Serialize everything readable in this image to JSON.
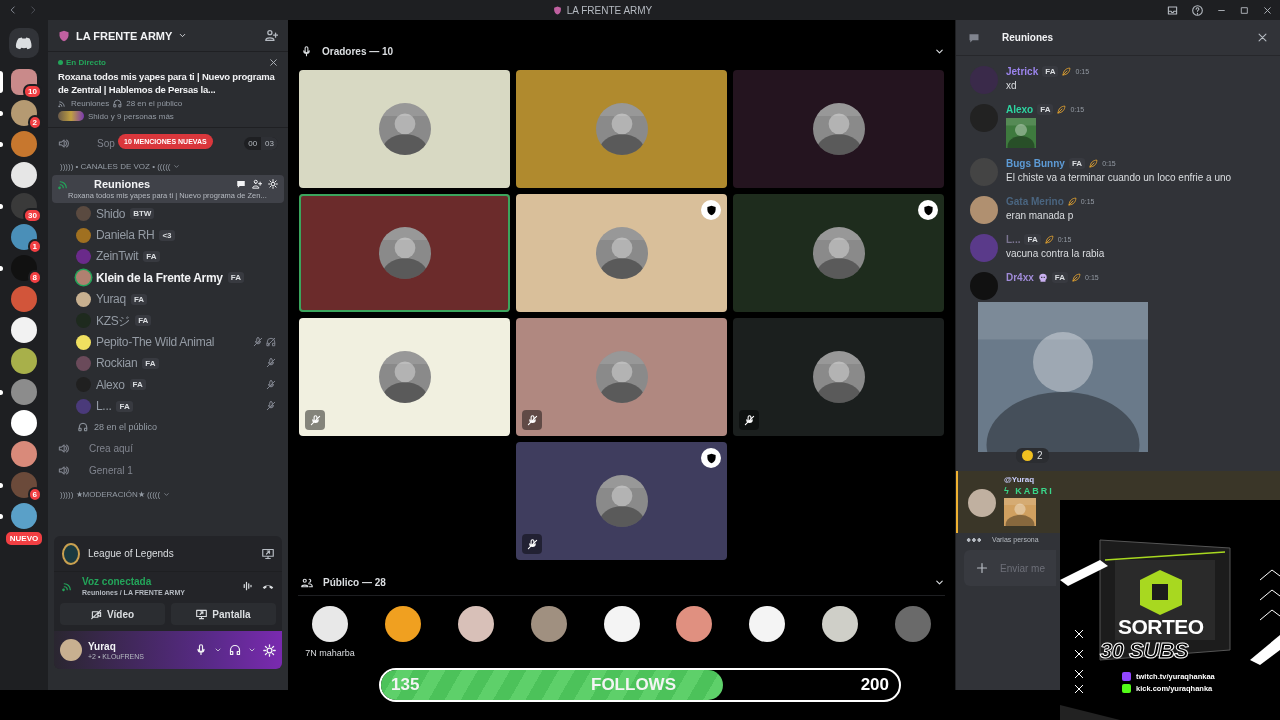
{
  "titlebar": {
    "title": "LA FRENTE ARMY"
  },
  "servers": [
    {
      "badge": "10",
      "selected": true,
      "color": "#c98a8a"
    },
    {
      "badge": "2",
      "selected": false,
      "unread": true,
      "color": "#b59a72"
    },
    {
      "selected": false,
      "unread": true,
      "color": "#c7772e"
    },
    {
      "selected": false,
      "unread": false,
      "color": "#e6e6e6"
    },
    {
      "badge": "30",
      "selected": false,
      "unread": true,
      "color": "#3a3a3a"
    },
    {
      "badge": "1",
      "selected": false,
      "unread": false,
      "color": "#4a8fb8"
    },
    {
      "badge": "8",
      "selected": false,
      "unread": true,
      "color": "#111111"
    },
    {
      "selected": false,
      "unread": false,
      "color": "#d2553a"
    },
    {
      "selected": false,
      "unread": false,
      "color": "#f2f2f2"
    },
    {
      "selected": false,
      "unread": false,
      "color": "#a8b04a"
    },
    {
      "selected": false,
      "unread": true,
      "color": "#8c8c8c"
    },
    {
      "selected": false,
      "unread": false,
      "color": "#ffffff"
    },
    {
      "selected": false,
      "unread": false,
      "color": "#d98a7a"
    },
    {
      "badge": "6",
      "selected": false,
      "unread": true,
      "color": "#6b4a3a"
    },
    {
      "badge": "NUEVO",
      "selected": false,
      "unread": true,
      "color": "#5aa0c8"
    }
  ],
  "sidebar": {
    "server_name": "LA FRENTE ARMY",
    "live": {
      "label": "En Directo",
      "title": "Roxana todos mis yapes para ti | Nuevo programa de Zentral | Hablemos de Persas la...",
      "channel": "Reuniones",
      "audience": "28 en el público",
      "participants": "Shido y 9 personas más"
    },
    "partial_channel": {
      "name": "Sop",
      "counts": [
        "00",
        "03"
      ]
    },
    "mentions": "10 MENCIONES NUEVAS",
    "voice_category": "))))) • CANALES DE VOZ • (((((",
    "active_channel": {
      "name": "Reuniones",
      "topic": "Roxana todos mis yapes para ti | Nuevo programa de Zen...",
      "selected": true
    },
    "members": [
      {
        "name": "Shido",
        "tag": "BTW",
        "speaking": false,
        "muted": false,
        "deafened": false,
        "color": "#5a4a40"
      },
      {
        "name": "Daniela RH",
        "tag": "<3",
        "speaking": false,
        "muted": false,
        "deafened": false,
        "color": "#a07020"
      },
      {
        "name": "ZeinTwit",
        "tag": "FA",
        "speaking": false,
        "muted": false,
        "deafened": false,
        "color": "#6a2a8a"
      },
      {
        "name": "Klein de la Frente Army",
        "tag": "FA",
        "speaking": true,
        "muted": false,
        "deafened": false,
        "color": "#b08070"
      },
      {
        "name": "Yuraq",
        "tag": "FA",
        "speaking": false,
        "muted": false,
        "deafened": false,
        "color": "#c8b090"
      },
      {
        "name": "KZSジ",
        "tag": "FA",
        "speaking": false,
        "muted": false,
        "deafened": false,
        "color": "#1e2a1e"
      },
      {
        "name": "Pepito-The Wild Animal",
        "speaking": false,
        "muted": true,
        "deafened": true,
        "color": "#f0e060"
      },
      {
        "name": "Rockian",
        "tag": "FA",
        "speaking": false,
        "muted": true,
        "deafened": false,
        "color": "#6a4a5a"
      },
      {
        "name": "Alexo",
        "tag": "FA",
        "speaking": false,
        "muted": true,
        "deafened": false,
        "color": "#202020"
      },
      {
        "name": "L...",
        "tag": "FA",
        "speaking": false,
        "muted": true,
        "deafened": false,
        "color": "#4a3a7a"
      }
    ],
    "audience": "28 en el público",
    "channels": [
      {
        "name": "Crea aquí"
      },
      {
        "name": "General 1"
      }
    ],
    "mod_category": "))))) ★MODERACIÓN★ (((((",
    "activity": "League of Legends",
    "voice": {
      "status": "Voz conectada",
      "location": "Reuniones / LA FRENTE ARMY",
      "buttons": [
        "Vídeo",
        "Pantalla"
      ]
    },
    "user": {
      "name": "Yuraq",
      "status": "+2 • KLOuFRENS"
    }
  },
  "stage": {
    "speakers_label": "Oradores — 10",
    "speakers": [
      {
        "color": "#d8d9c3",
        "speaking": false,
        "muted": false,
        "moderator": false
      },
      {
        "color": "#b08a2e",
        "speaking": false,
        "muted": false,
        "moderator": false
      },
      {
        "color": "#24141f",
        "speaking": false,
        "muted": false,
        "moderator": false
      },
      {
        "color": "#6b2b2b",
        "speaking": true,
        "muted": false,
        "moderator": false
      },
      {
        "color": "#d9bf9a",
        "speaking": false,
        "muted": false,
        "moderator": true
      },
      {
        "color": "#1e2c1d",
        "speaking": false,
        "muted": false,
        "moderator": true
      },
      {
        "color": "#f1f0e0",
        "speaking": false,
        "muted": true,
        "moderator": false
      },
      {
        "color": "#b08880",
        "speaking": false,
        "muted": true,
        "moderator": false
      },
      {
        "color": "#1b1f1e",
        "speaking": false,
        "muted": true,
        "moderator": false
      },
      {
        "color": "#3f3d5e",
        "speaking": false,
        "muted": true,
        "moderator": true
      }
    ],
    "audience_label": "Público — 28",
    "audience": [
      {
        "name": "7N maharba",
        "color": "#e8e8e8"
      },
      {
        "color": "#f0a020"
      },
      {
        "color": "#d8c0b8"
      },
      {
        "color": "#a09080"
      },
      {
        "color": "#f4f4f4"
      },
      {
        "color": "#e09080"
      },
      {
        "color": "#f4f4f4"
      },
      {
        "color": "#cfcfc8"
      },
      {
        "color": "#6a6a6a"
      }
    ]
  },
  "follows": {
    "current": "135",
    "label": "FOLLOWS",
    "goal": "200",
    "level": 0.66
  },
  "chat": {
    "channel": "Reuniones",
    "messages": [
      {
        "author": "Jetrick",
        "color": "#9b84ec",
        "tag": "FA",
        "time": "0:15",
        "kind": "text",
        "text": "xd"
      },
      {
        "author": "Alexo",
        "color": "#2dd4a0",
        "tag": "FA",
        "time": "0:15",
        "kind": "sticker"
      },
      {
        "author": "Bugs Bunny",
        "color": "#5d9bd6",
        "tag": "FA",
        "time": "0:15",
        "kind": "text",
        "text": "El chiste va a terminar cuando un loco enfrie a uno"
      },
      {
        "author": "Gata Merino",
        "color": "#4a6580",
        "time": "0:15",
        "kind": "text",
        "text": "eran manada p"
      },
      {
        "author": "L...",
        "color": "#7a7490",
        "tag": "FA",
        "time": "0:15",
        "kind": "text",
        "text": "vacuna contra la rabia"
      },
      {
        "author": "Dr4xx",
        "color": "#a08bd8",
        "tag": "FA",
        "time": "0:15"
      }
    ],
    "reactions": [
      {
        "count": "2"
      }
    ],
    "reply": {
      "mention": "@Yuraq",
      "author": "ϟ KABRI"
    },
    "typing": "Varias persona",
    "input_placeholder": "Enviar me"
  },
  "overlay": {
    "title": "SORTEO",
    "subtitle": "30 SUBS",
    "links": [
      {
        "kind": "twitch",
        "text": "twitch.tv/yuraqhankaa"
      },
      {
        "kind": "kick",
        "text": "kick.com/yuraqhanka"
      }
    ]
  }
}
